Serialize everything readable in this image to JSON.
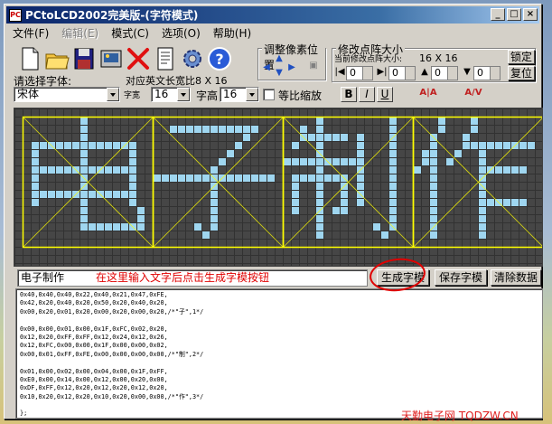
{
  "window": {
    "title": "PCtoLCD2002完美版-(字符模式)",
    "buttons": {
      "minimize": "_",
      "maximize": "□",
      "close": "×"
    }
  },
  "menu": {
    "items": [
      {
        "label": "文件(F)",
        "disabled": false
      },
      {
        "label": "编辑(E)",
        "disabled": true
      },
      {
        "label": "模式(C)",
        "disabled": false
      },
      {
        "label": "选项(O)",
        "disabled": false
      },
      {
        "label": "帮助(H)",
        "disabled": false
      }
    ]
  },
  "toolbar": {
    "icons": [
      "new-file-icon",
      "open-folder-icon",
      "save-disk-icon",
      "import-image-icon",
      "delete-x-icon",
      "document-icon",
      "settings-gear-icon",
      "help-question-icon"
    ]
  },
  "pixel_adjust": {
    "label": "调整像素位置"
  },
  "matrix_size": {
    "label": "修改点阵大小",
    "current_label": "当前修改点阵大小:",
    "current_value": "16 X 16",
    "lock_button": "锁定",
    "reset_button": "复位",
    "spins": [
      "0",
      "0",
      "0",
      "0"
    ]
  },
  "font_select": {
    "label": "请选择字体:",
    "value": "宋体",
    "ratio_label": "对应英文长宽比8 X 16",
    "width_label": "字宽",
    "width_value": "16",
    "height_label": "字高",
    "height_value": "16",
    "scale_label": "等比缩放",
    "format": {
      "bold": "B",
      "italic": "I",
      "underline": "U"
    }
  },
  "editor": {
    "input_value": "电子制作",
    "hint": "在这里输入文字后点击生成字模按钮",
    "generate_button": "生成字模",
    "save_button": "保存字模",
    "clear_button": "清除数据"
  },
  "output": {
    "lines": [
      "0x40,0x40,0x40,0x22,0x40,0x21,0x47,0xFE,",
      "0x42,0x20,0x40,0x20,0x50,0x20,0x40,0x20,",
      "0x00,0x20,0x01,0x20,0x00,0x20,0x00,0x20,/*\"子\",1*/",
      "",
      "0x00,0x00,0x01,0x00,0x1F,0xFC,0x02,0x20,",
      "0x12,0x20,0xFF,0xFF,0x12,0x24,0x12,0x26,",
      "0x12,0xFC,0x00,0x00,0x1F,0x00,0x00,0x02,",
      "0x00,0x01,0xFF,0xFE,0x00,0x00,0x00,0x00,/*\"制\",2*/",
      "",
      "0x01,0x00,0x02,0x00,0x04,0x00,0x1F,0xFF,",
      "0xE0,0x00,0x14,0x00,0x12,0x00,0x20,0x00,",
      "0xDF,0xFF,0x12,0x20,0x12,0x20,0x12,0x20,",
      "0x10,0x20,0x12,0x20,0x10,0x20,0x00,0x00,/*\"作\",3*/",
      "",
      "};"
    ]
  },
  "watermark": "天勤电子网 TQDZW.CN",
  "colors": {
    "pixel_on": "#9fd6f0",
    "pixel_off": "#464646",
    "grid": "#323232",
    "frame": "#ffff00",
    "hint": "#e00000"
  },
  "matrix": {
    "cols": 70,
    "rows": 20,
    "chars": [
      {
        "char": "电",
        "col0": 1,
        "row0": 1
      },
      {
        "char": "子",
        "col0": 17,
        "row0": 1
      },
      {
        "char": "制",
        "col0": 33,
        "row0": 1
      },
      {
        "char": "作",
        "col0": 49,
        "row0": 1
      }
    ]
  }
}
